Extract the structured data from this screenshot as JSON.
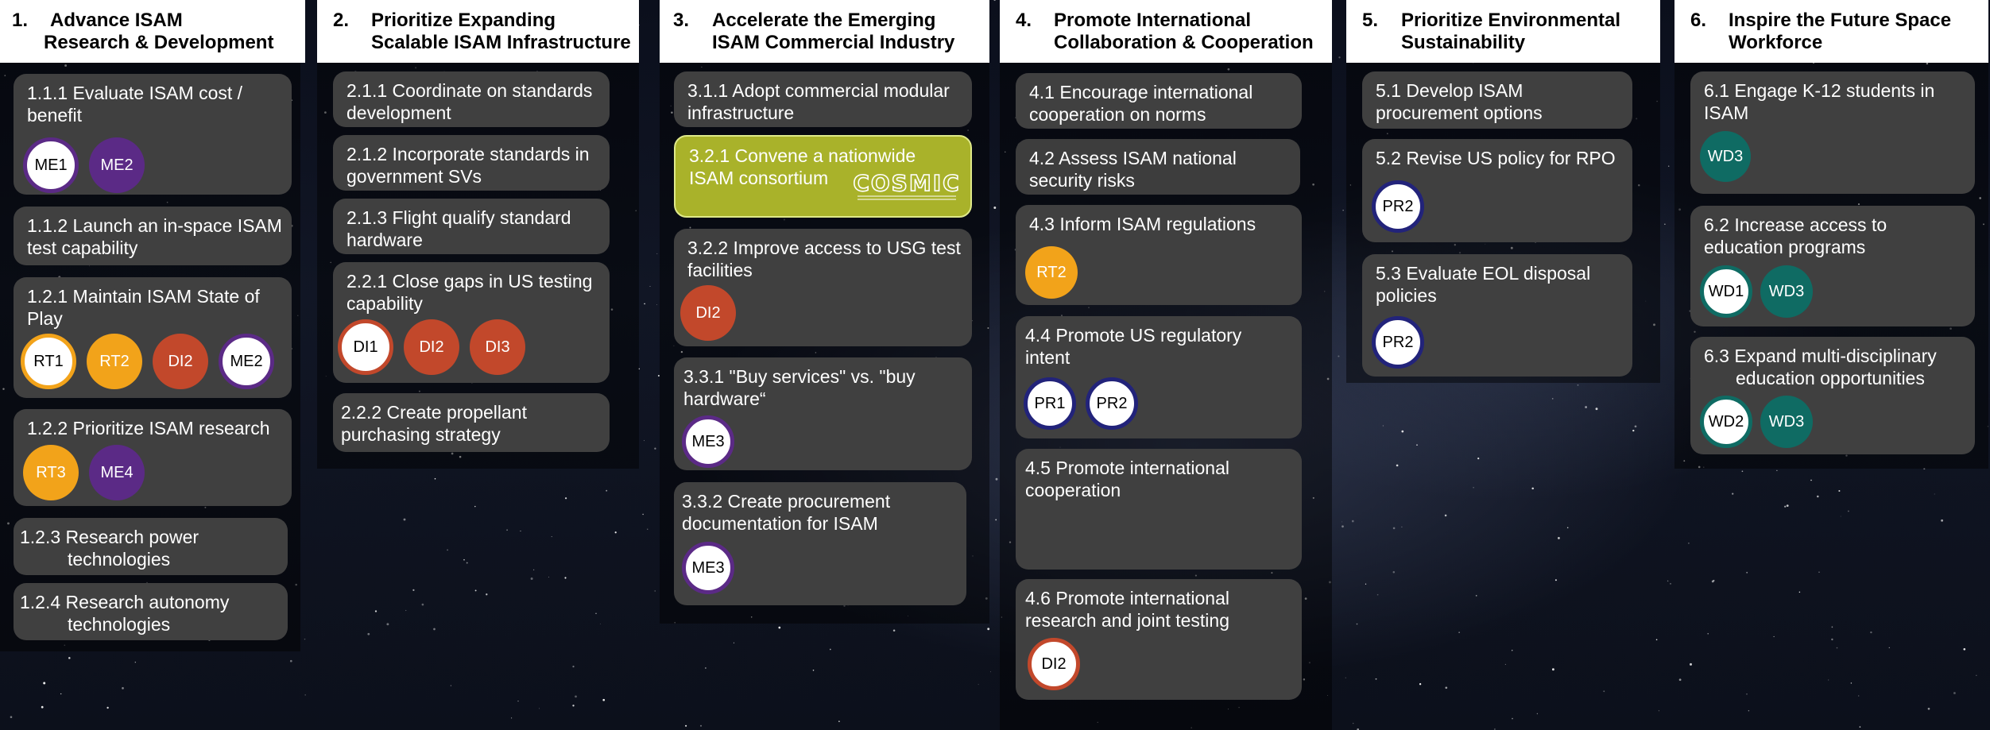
{
  "colors": {
    "ME": "#5b2a86",
    "RT": "#f2a31a",
    "DI": "#c2482b",
    "PR": "#22237a",
    "WD": "#0f6b63"
  },
  "columns": [
    {
      "number": "1.",
      "title_lines": [
        "Advance ISAM",
        "Research & Development"
      ],
      "cards": [
        {
          "text": "1.1.1 Evaluate ISAM cost / benefit",
          "badges": [
            {
              "label": "ME1",
              "variant": "outline",
              "group": "ME"
            },
            {
              "label": "ME2",
              "variant": "filled",
              "group": "ME"
            }
          ]
        },
        {
          "text": "1.1.2 Launch an in-space ISAM test capability",
          "badges": []
        },
        {
          "text": "1.2.1 Maintain ISAM State of Play",
          "badges": [
            {
              "label": "RT1",
              "variant": "outline",
              "group": "RT"
            },
            {
              "label": "RT2",
              "variant": "filled",
              "group": "RT"
            },
            {
              "label": "DI2",
              "variant": "filled",
              "group": "DI"
            },
            {
              "label": "ME2",
              "variant": "outline",
              "group": "ME"
            }
          ]
        },
        {
          "text": "1.2.2 Prioritize ISAM research",
          "badges": [
            {
              "label": "RT3",
              "variant": "filled",
              "group": "RT"
            },
            {
              "label": "ME4",
              "variant": "filled",
              "group": "ME"
            }
          ]
        },
        {
          "text": "1.2.3 Research power technologies",
          "badges": []
        },
        {
          "text": "1.2.4 Research autonomy technologies",
          "badges": []
        }
      ]
    },
    {
      "number": "2.",
      "title_lines": [
        "Prioritize Expanding",
        "Scalable ISAM Infrastructure"
      ],
      "cards": [
        {
          "text": "2.1.1 Coordinate on standards development",
          "badges": []
        },
        {
          "text": "2.1.2 Incorporate standards in government SVs",
          "badges": []
        },
        {
          "text": "2.1.3 Flight qualify standard hardware",
          "badges": []
        },
        {
          "text": "2.2.1 Close gaps in US testing capability",
          "badges": [
            {
              "label": "DI1",
              "variant": "outline",
              "group": "DI"
            },
            {
              "label": "DI2",
              "variant": "filled",
              "group": "DI"
            },
            {
              "label": "DI3",
              "variant": "filled",
              "group": "DI"
            }
          ]
        },
        {
          "text": "2.2.2 Create propellant purchasing strategy",
          "badges": []
        }
      ]
    },
    {
      "number": "3.",
      "title_lines": [
        "Accelerate the Emerging",
        "ISAM Commercial Industry"
      ],
      "cards": [
        {
          "text": "3.1.1 Adopt commercial modular infrastructure",
          "badges": []
        },
        {
          "text": "3.2.1 Convene a nationwide ISAM consortium",
          "badges": [],
          "logo_text": "COSMIC"
        },
        {
          "text": "3.2.2 Improve access to USG test facilities",
          "badges": [
            {
              "label": "DI2",
              "variant": "filled",
              "group": "DI"
            }
          ]
        },
        {
          "text": "3.3.1 \"Buy services\" vs. \"buy hardware“",
          "badges": [
            {
              "label": "ME3",
              "variant": "outline",
              "group": "ME"
            }
          ]
        },
        {
          "text": "3.3.2 Create procurement documentation for ISAM",
          "badges": [
            {
              "label": "ME3",
              "variant": "outline",
              "group": "ME"
            }
          ]
        }
      ]
    },
    {
      "number": "4.",
      "title_lines": [
        "Promote International",
        "Collaboration & Cooperation"
      ],
      "cards": [
        {
          "text": "4.1 Encourage international cooperation on norms",
          "badges": []
        },
        {
          "text": "4.2 Assess ISAM national security risks",
          "badges": []
        },
        {
          "text": "4.3 Inform ISAM regulations",
          "badges": [
            {
              "label": "RT2",
              "variant": "filled",
              "group": "RT"
            }
          ]
        },
        {
          "text": "4.4 Promote US regulatory intent",
          "badges": [
            {
              "label": "PR1",
              "variant": "outline",
              "group": "PR"
            },
            {
              "label": "PR2",
              "variant": "outline",
              "group": "PR"
            }
          ]
        },
        {
          "text": "4.5 Promote international cooperation",
          "badges": []
        },
        {
          "text": "4.6 Promote international research and joint testing",
          "badges": [
            {
              "label": "DI2",
              "variant": "outline",
              "group": "DI"
            }
          ]
        }
      ]
    },
    {
      "number": "5.",
      "title_lines": [
        "Prioritize Environmental",
        "Sustainability"
      ],
      "cards": [
        {
          "text": "5.1 Develop ISAM procurement options",
          "badges": []
        },
        {
          "text": "5.2 Revise US policy for RPO",
          "badges": [
            {
              "label": "PR2",
              "variant": "outline",
              "group": "PR"
            }
          ]
        },
        {
          "text": "5.3 Evaluate EOL disposal policies",
          "badges": [
            {
              "label": "PR2",
              "variant": "outline",
              "group": "PR"
            }
          ]
        }
      ]
    },
    {
      "number": "6.",
      "title_lines": [
        "Inspire the Future Space",
        "Workforce"
      ],
      "cards": [
        {
          "text": "6.1 Engage K-12 students in ISAM",
          "badges": [
            {
              "label": "WD3",
              "variant": "filled",
              "group": "WD"
            }
          ]
        },
        {
          "text": "6.2 Increase access to education programs",
          "badges": [
            {
              "label": "WD1",
              "variant": "outline",
              "group": "WD"
            },
            {
              "label": "WD3",
              "variant": "filled",
              "group": "WD"
            }
          ]
        },
        {
          "text": "6.3 Expand multi-disciplinary education opportunities",
          "badges": [
            {
              "label": "WD2",
              "variant": "outline",
              "group": "WD"
            },
            {
              "label": "WD3",
              "variant": "filled",
              "group": "WD"
            }
          ]
        }
      ]
    }
  ]
}
